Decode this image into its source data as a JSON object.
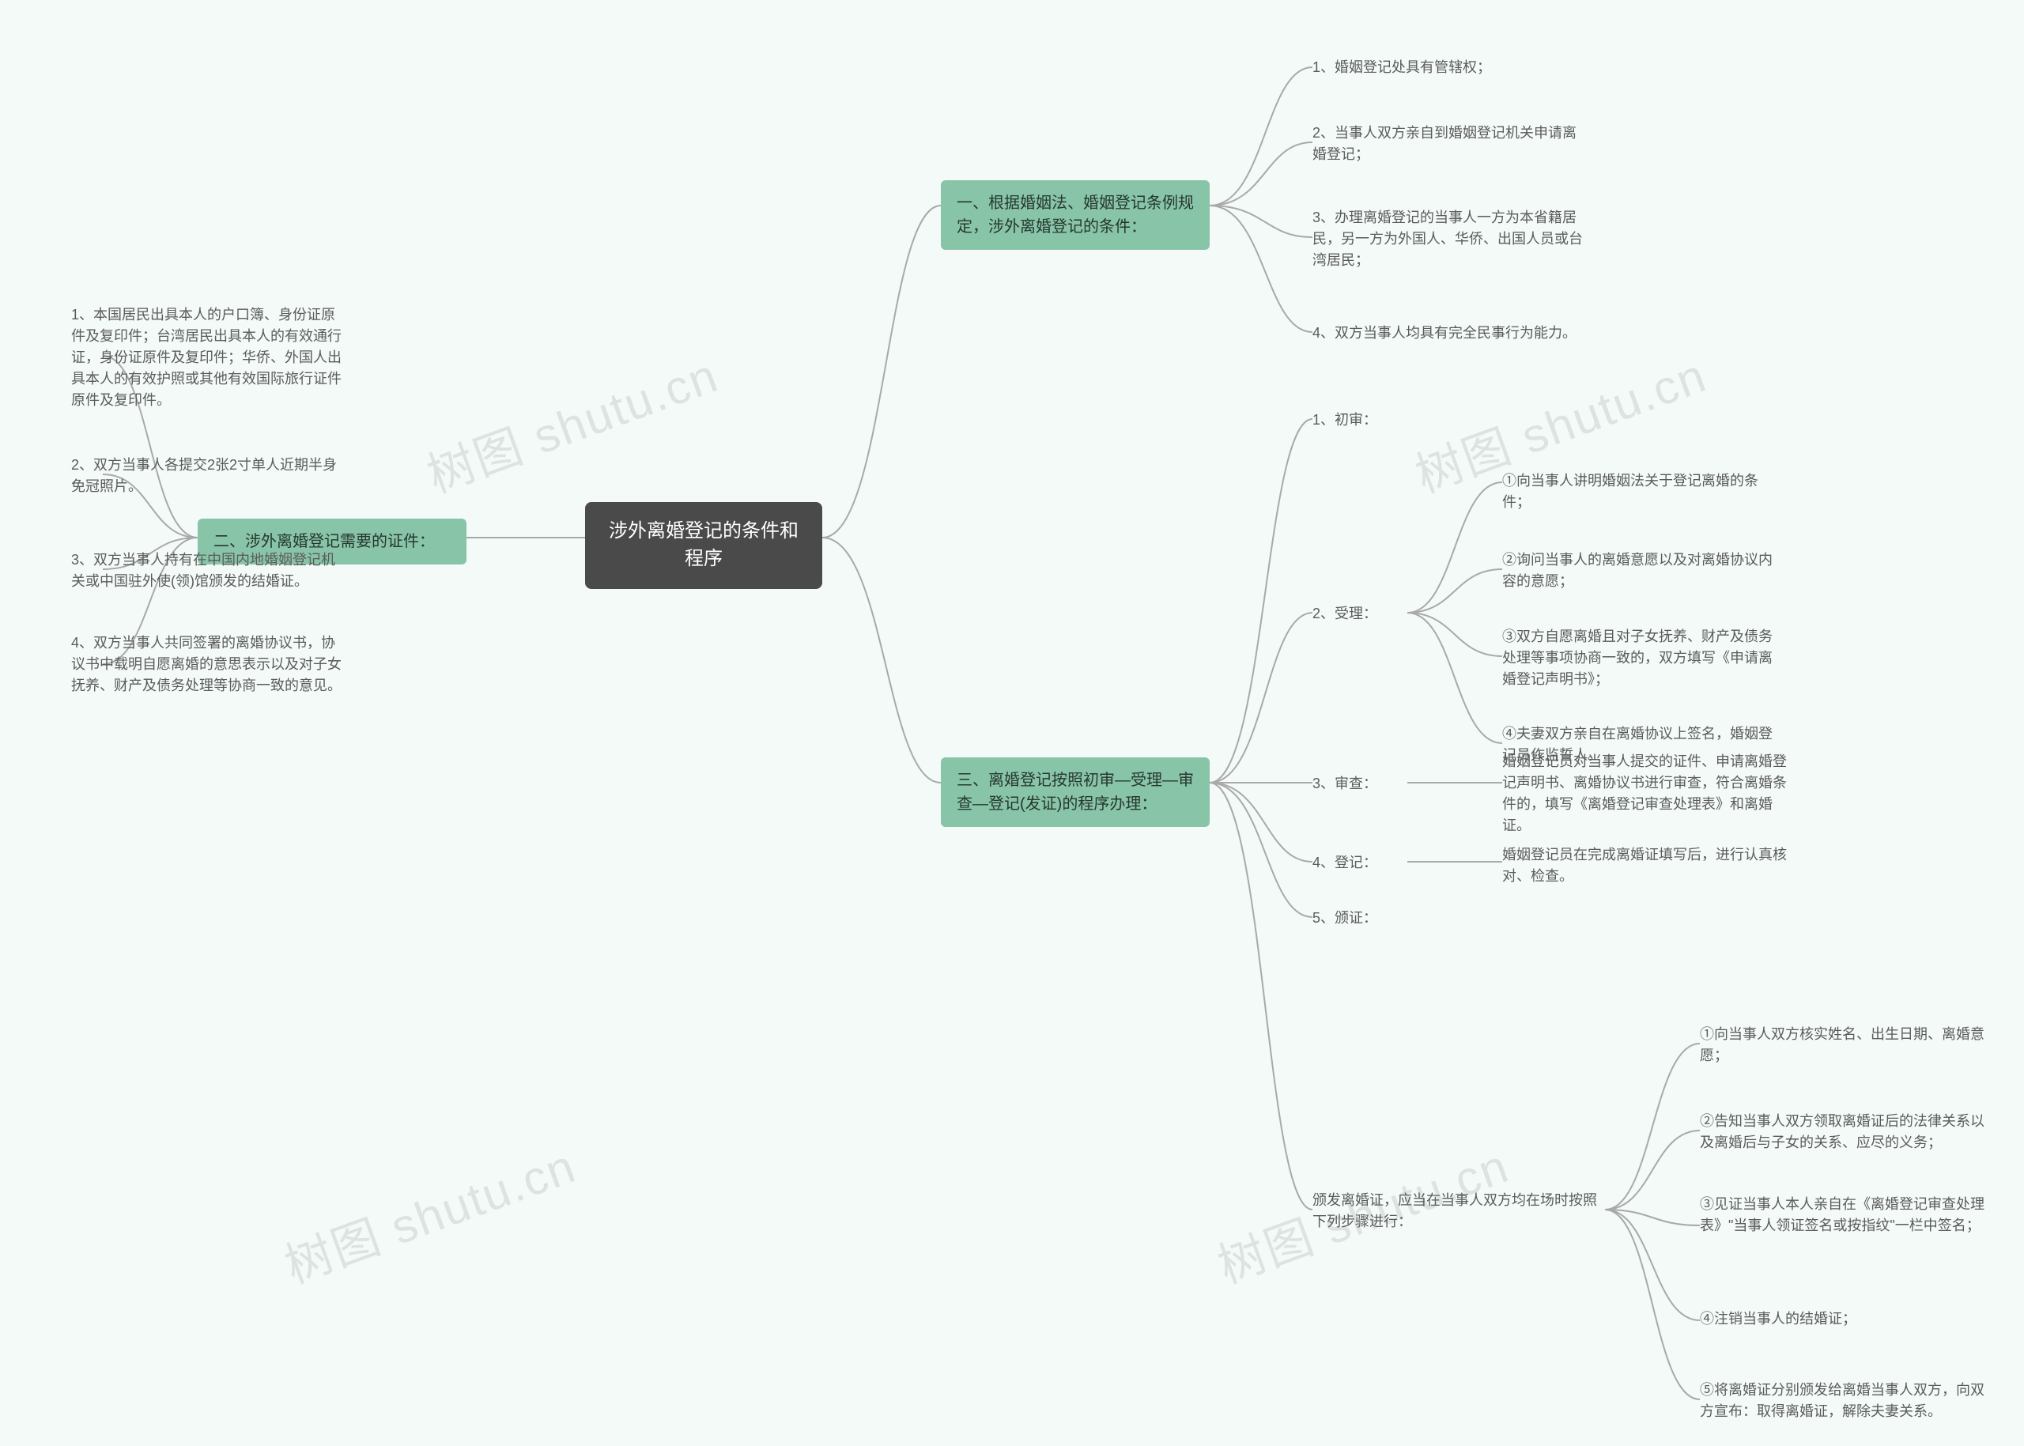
{
  "root": {
    "title": "涉外离婚登记的条件和程序"
  },
  "section1": {
    "title": "一、根据婚姻法、婚姻登记条例规定，涉外离婚登记的条件：",
    "items": [
      "1、婚姻登记处具有管辖权；",
      "2、当事人双方亲自到婚姻登记机关申请离婚登记；",
      "3、办理离婚登记的当事人一方为本省籍居民，另一方为外国人、华侨、出国人员或台湾居民；",
      "4、双方当事人均具有完全民事行为能力。"
    ]
  },
  "section2": {
    "title": "二、涉外离婚登记需要的证件：",
    "items": [
      "1、本国居民出具本人的户口簿、身份证原件及复印件；台湾居民出具本人的有效通行证，身份证原件及复印件；华侨、外国人出具本人的有效护照或其他有效国际旅行证件原件及复印件。",
      "2、双方当事人各提交2张2寸单人近期半身免冠照片。",
      "3、双方当事人持有在中国内地婚姻登记机关或中国驻外使(领)馆颁发的结婚证。",
      "4、双方当事人共同签署的离婚协议书，协议书中载明自愿离婚的意思表示以及对子女抚养、财产及债务处理等协商一致的意见。"
    ]
  },
  "section3": {
    "title": "三、离婚登记按照初审—受理—审查—登记(发证)的程序办理：",
    "steps": {
      "s1": {
        "label": "1、初审："
      },
      "s2": {
        "label": "2、受理：",
        "items": [
          "①向当事人讲明婚姻法关于登记离婚的条件；",
          "②询问当事人的离婚意愿以及对离婚协议内容的意愿；",
          "③双方自愿离婚且对子女抚养、财产及债务处理等事项协商一致的，双方填写《申请离婚登记声明书》；",
          "④夫妻双方亲自在离婚协议上签名，婚姻登记员作监誓人。"
        ]
      },
      "s3": {
        "label": "3、审查：",
        "detail": "婚姻登记员对当事人提交的证件、申请离婚登记声明书、离婚协议书进行审查，符合离婚条件的，填写《离婚登记审查处理表》和离婚证。"
      },
      "s4": {
        "label": "4、登记：",
        "detail": "婚姻登记员在完成离婚证填写后，进行认真核对、检查。"
      },
      "s5": {
        "label": "5、颁证："
      }
    },
    "issue": {
      "title": "颁发离婚证，应当在当事人双方均在场时按照下列步骤进行：",
      "items": [
        "①向当事人双方核实姓名、出生日期、离婚意愿；",
        "②告知当事人双方领取离婚证后的法律关系以及离婚后与子女的关系、应尽的义务；",
        "③见证当事人本人亲自在《离婚登记审查处理表》\"当事人领证签名或按指纹\"一栏中签名；",
        "④注销当事人的结婚证；",
        "⑤将离婚证分别颁发给离婚当事人双方，向双方宣布：取得离婚证，解除夫妻关系。"
      ]
    }
  },
  "watermark": "树图 shutu.cn"
}
